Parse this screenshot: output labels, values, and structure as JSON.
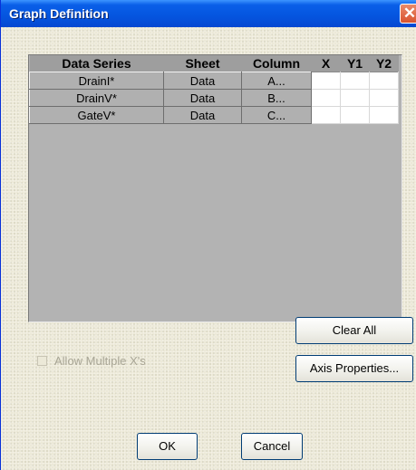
{
  "window": {
    "title": "Graph Definition",
    "close_glyph": "✕"
  },
  "grid": {
    "headers": [
      "Data Series",
      "Sheet",
      "Column",
      "X",
      "Y1",
      "Y2"
    ],
    "rows": [
      {
        "series": "DrainI*",
        "sheet": "Data",
        "column": "A..."
      },
      {
        "series": "DrainV*",
        "sheet": "Data",
        "column": "B..."
      },
      {
        "series": "GateV*",
        "sheet": "Data",
        "column": "C..."
      }
    ]
  },
  "controls": {
    "allow_multiple_x_label": "Allow Multiple X's",
    "allow_multiple_x_checked": false,
    "clear_all_label": "Clear All",
    "axis_properties_label": "Axis Properties...",
    "ok_label": "OK",
    "cancel_label": "Cancel"
  },
  "colors": {
    "title_bar": "#0556e0",
    "dialog_face": "#ece9d8",
    "grid_background": "#b3b3b3"
  }
}
